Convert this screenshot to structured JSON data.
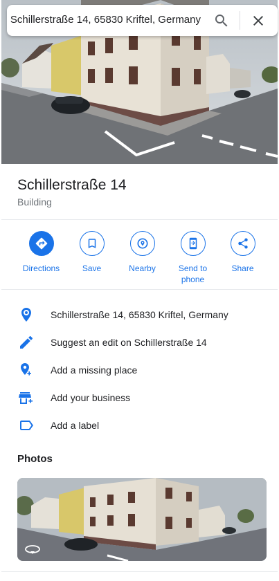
{
  "search": {
    "value": "Schillerstraße 14, 65830 Kriftel, Germany",
    "search_icon": "search-icon",
    "close_icon": "close-icon"
  },
  "place": {
    "title": "Schillerstraße 14",
    "category": "Building"
  },
  "actions": [
    {
      "label": "Directions",
      "icon": "directions-icon"
    },
    {
      "label": "Save",
      "icon": "bookmark-icon"
    },
    {
      "label": "Nearby",
      "icon": "nearby-icon"
    },
    {
      "label": "Send to phone",
      "icon": "send-to-phone-icon"
    },
    {
      "label": "Share",
      "icon": "share-icon"
    }
  ],
  "info": [
    {
      "text": "Schillerstraße 14, 65830 Kriftel, Germany",
      "icon": "location-pin-icon"
    },
    {
      "text": "Suggest an edit on Schillerstraße 14",
      "icon": "pencil-icon"
    },
    {
      "text": "Add a missing place",
      "icon": "add-location-icon"
    },
    {
      "text": "Add your business",
      "icon": "add-business-icon"
    },
    {
      "text": "Add a label",
      "icon": "label-icon"
    }
  ],
  "photos": {
    "heading": "Photos",
    "overlay_icon": "street-view-icon"
  },
  "colors": {
    "accent": "#1a73e8",
    "text_primary": "#202124",
    "text_secondary": "#70757a",
    "divider": "#e8eaed"
  }
}
